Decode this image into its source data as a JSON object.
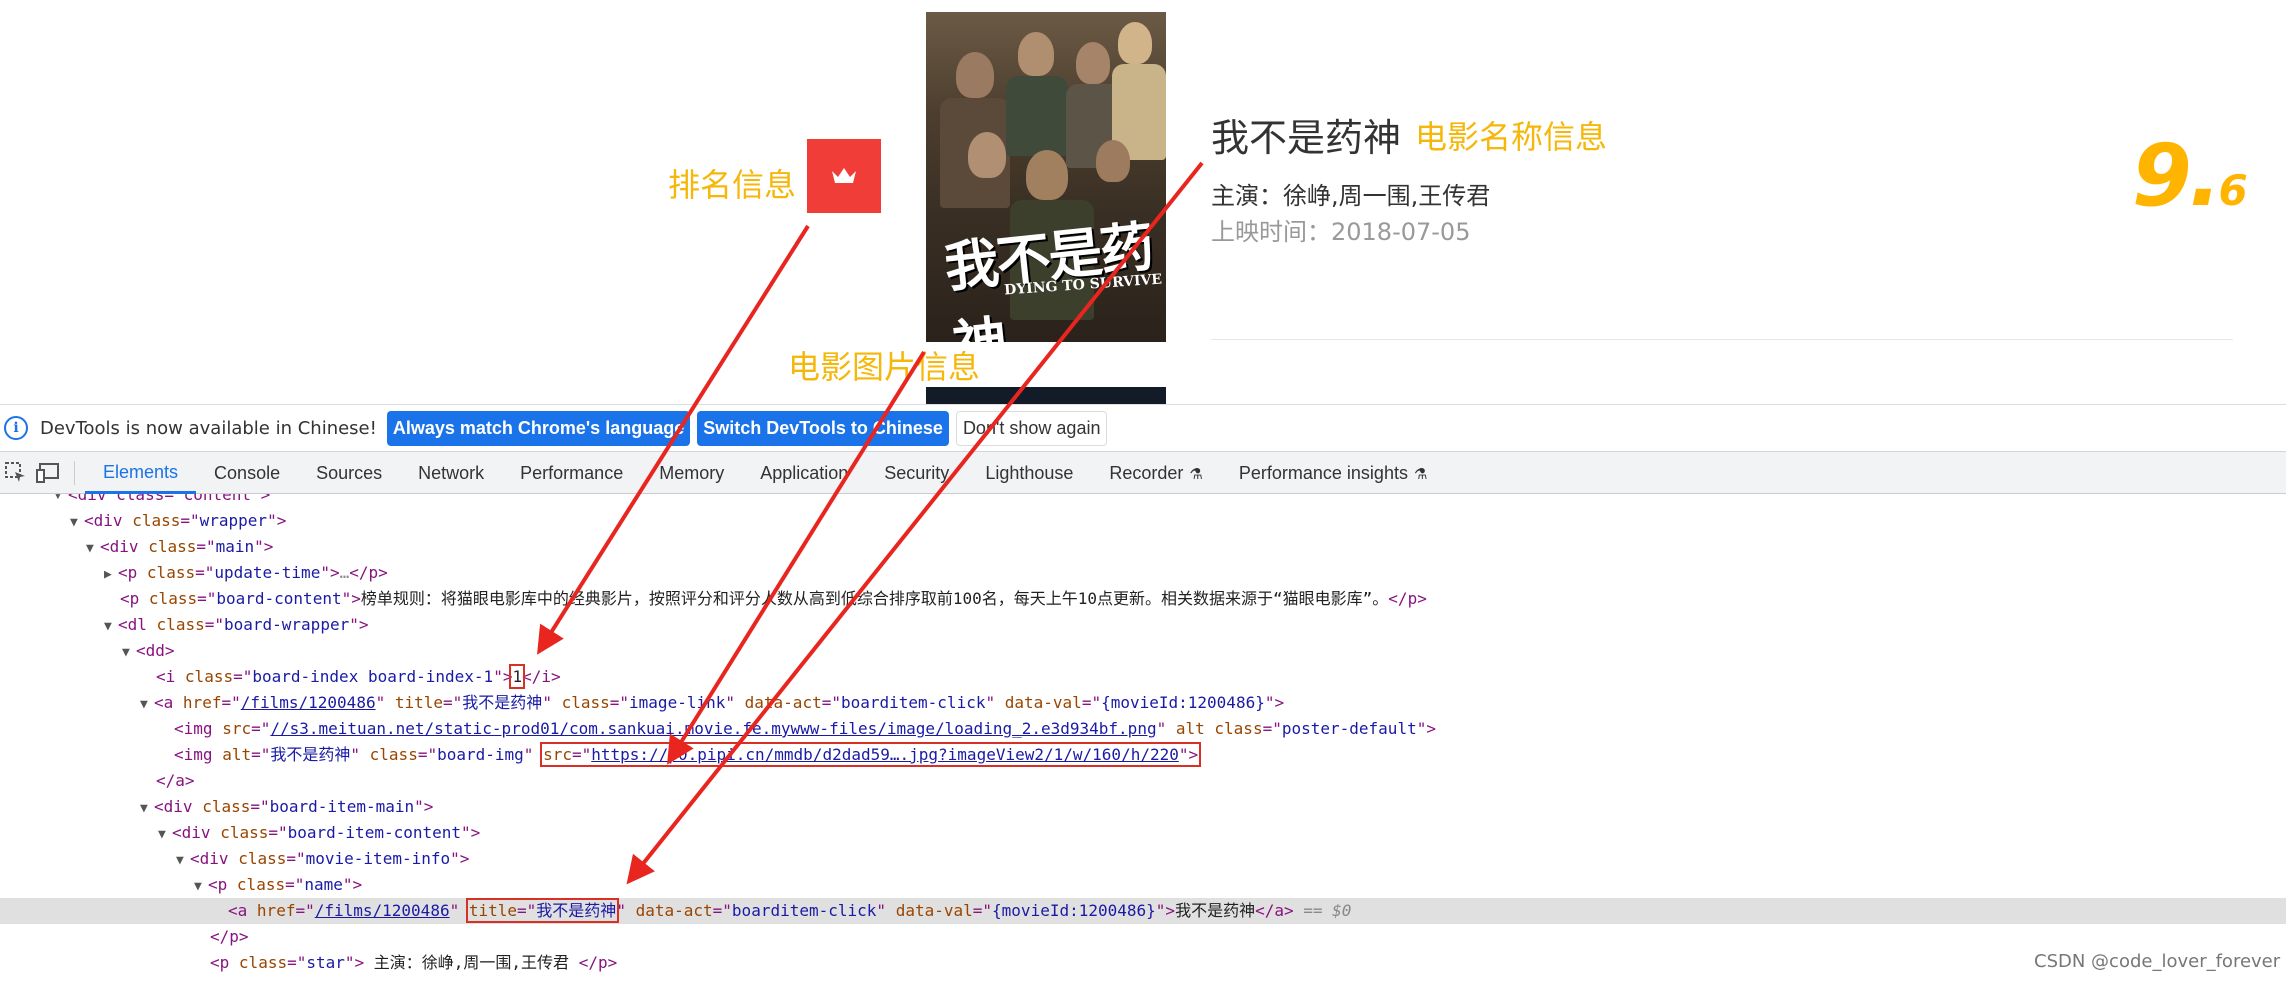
{
  "page": {
    "movie_name": "我不是药神",
    "star": "主演：徐峥,周一围,王传君",
    "release_time": "上映时间：2018-07-05",
    "score_int": "9.",
    "score_frac": "6",
    "poster_title": "我不是药神",
    "poster_subtitle": "DYING TO SURVIVE",
    "annotations": {
      "name_info": "电影名称信息",
      "rank_info": "排名信息",
      "image_info": "电影图片信息"
    },
    "accent_color": "#f5b70a",
    "rank_color": "#f03d37",
    "score_color": "#ffb400"
  },
  "notice": {
    "text": "DevTools is now available in Chinese!",
    "match_button": "Always match Chrome's language",
    "switch_button": "Switch DevTools to Chinese",
    "dismiss_button": "Don't show again"
  },
  "tabs": [
    {
      "label": "Elements"
    },
    {
      "label": "Console"
    },
    {
      "label": "Sources"
    },
    {
      "label": "Network"
    },
    {
      "label": "Performance"
    },
    {
      "label": "Memory"
    },
    {
      "label": "Application"
    },
    {
      "label": "Security"
    },
    {
      "label": "Lighthouse"
    },
    {
      "label": "Recorder"
    },
    {
      "label": "Performance insights"
    }
  ],
  "dom": {
    "r0": {
      "text": "<div class=\"content\">"
    },
    "r1": {
      "tag": "div",
      "attr": "class",
      "val": "wrapper"
    },
    "r2": {
      "tag": "div",
      "attr": "class",
      "val": "main"
    },
    "r3": {
      "tag": "p",
      "attr": "class",
      "val": "update-time",
      "ellipsis": "…",
      "close": "</p>"
    },
    "r4": {
      "tag": "p",
      "attr": "class",
      "val": "board-content",
      "text": "榜单规则：将猫眼电影库中的经典影片，按照评分和评分人数从高到低综合排序取前100名，每天上午10点更新。相关数据来源于“猫眼电影库”。",
      "close": "</p>"
    },
    "r5": {
      "tag": "dl",
      "attr": "class",
      "val": "board-wrapper"
    },
    "r6": {
      "tag": "dd"
    },
    "r7": {
      "tag": "i",
      "attr": "class",
      "val": "board-index board-index-1",
      "text": "1",
      "close": "</i>"
    },
    "r8": {
      "tag": "a",
      "href": "/films/1200486",
      "title": "我不是药神",
      "class": "image-link",
      "data_act": "boarditem-click",
      "data_val": "{movieId:1200486}"
    },
    "r9": {
      "tag": "img",
      "src": "//s3.meituan.net/static-prod01/com.sankuai.movie.fe.mywww-files/image/loading_2.e3d934bf.png",
      "alt_attr": "alt",
      "class": "poster-default"
    },
    "r10": {
      "tag": "img",
      "alt": "我不是药神",
      "class": "board-img",
      "src": "https://p0.pipi.cn/mmdb/d2dad59….jpg?imageView2/1/w/160/h/220"
    },
    "r11": {
      "close": "</a>"
    },
    "r12": {
      "tag": "div",
      "attr": "class",
      "val": "board-item-main"
    },
    "r13": {
      "tag": "div",
      "attr": "class",
      "val": "board-item-content"
    },
    "r14": {
      "tag": "div",
      "attr": "class",
      "val": "movie-item-info"
    },
    "r15": {
      "tag": "p",
      "attr": "class",
      "val": "name"
    },
    "r16": {
      "tag": "a",
      "href": "/films/1200486",
      "title": "我不是药神",
      "data_act": "boarditem-click",
      "data_val": "{movieId:1200486}",
      "text": "我不是药神",
      "close": "</a>",
      "eq": "== $0"
    },
    "r17": {
      "close": "</p>"
    },
    "r18": {
      "tag": "p",
      "attr": "class",
      "val": "star",
      "text": " 主演：徐峥,周一围,王传君 ",
      "close": "</p>"
    }
  },
  "watermark": "CSDN @code_lover_forever"
}
